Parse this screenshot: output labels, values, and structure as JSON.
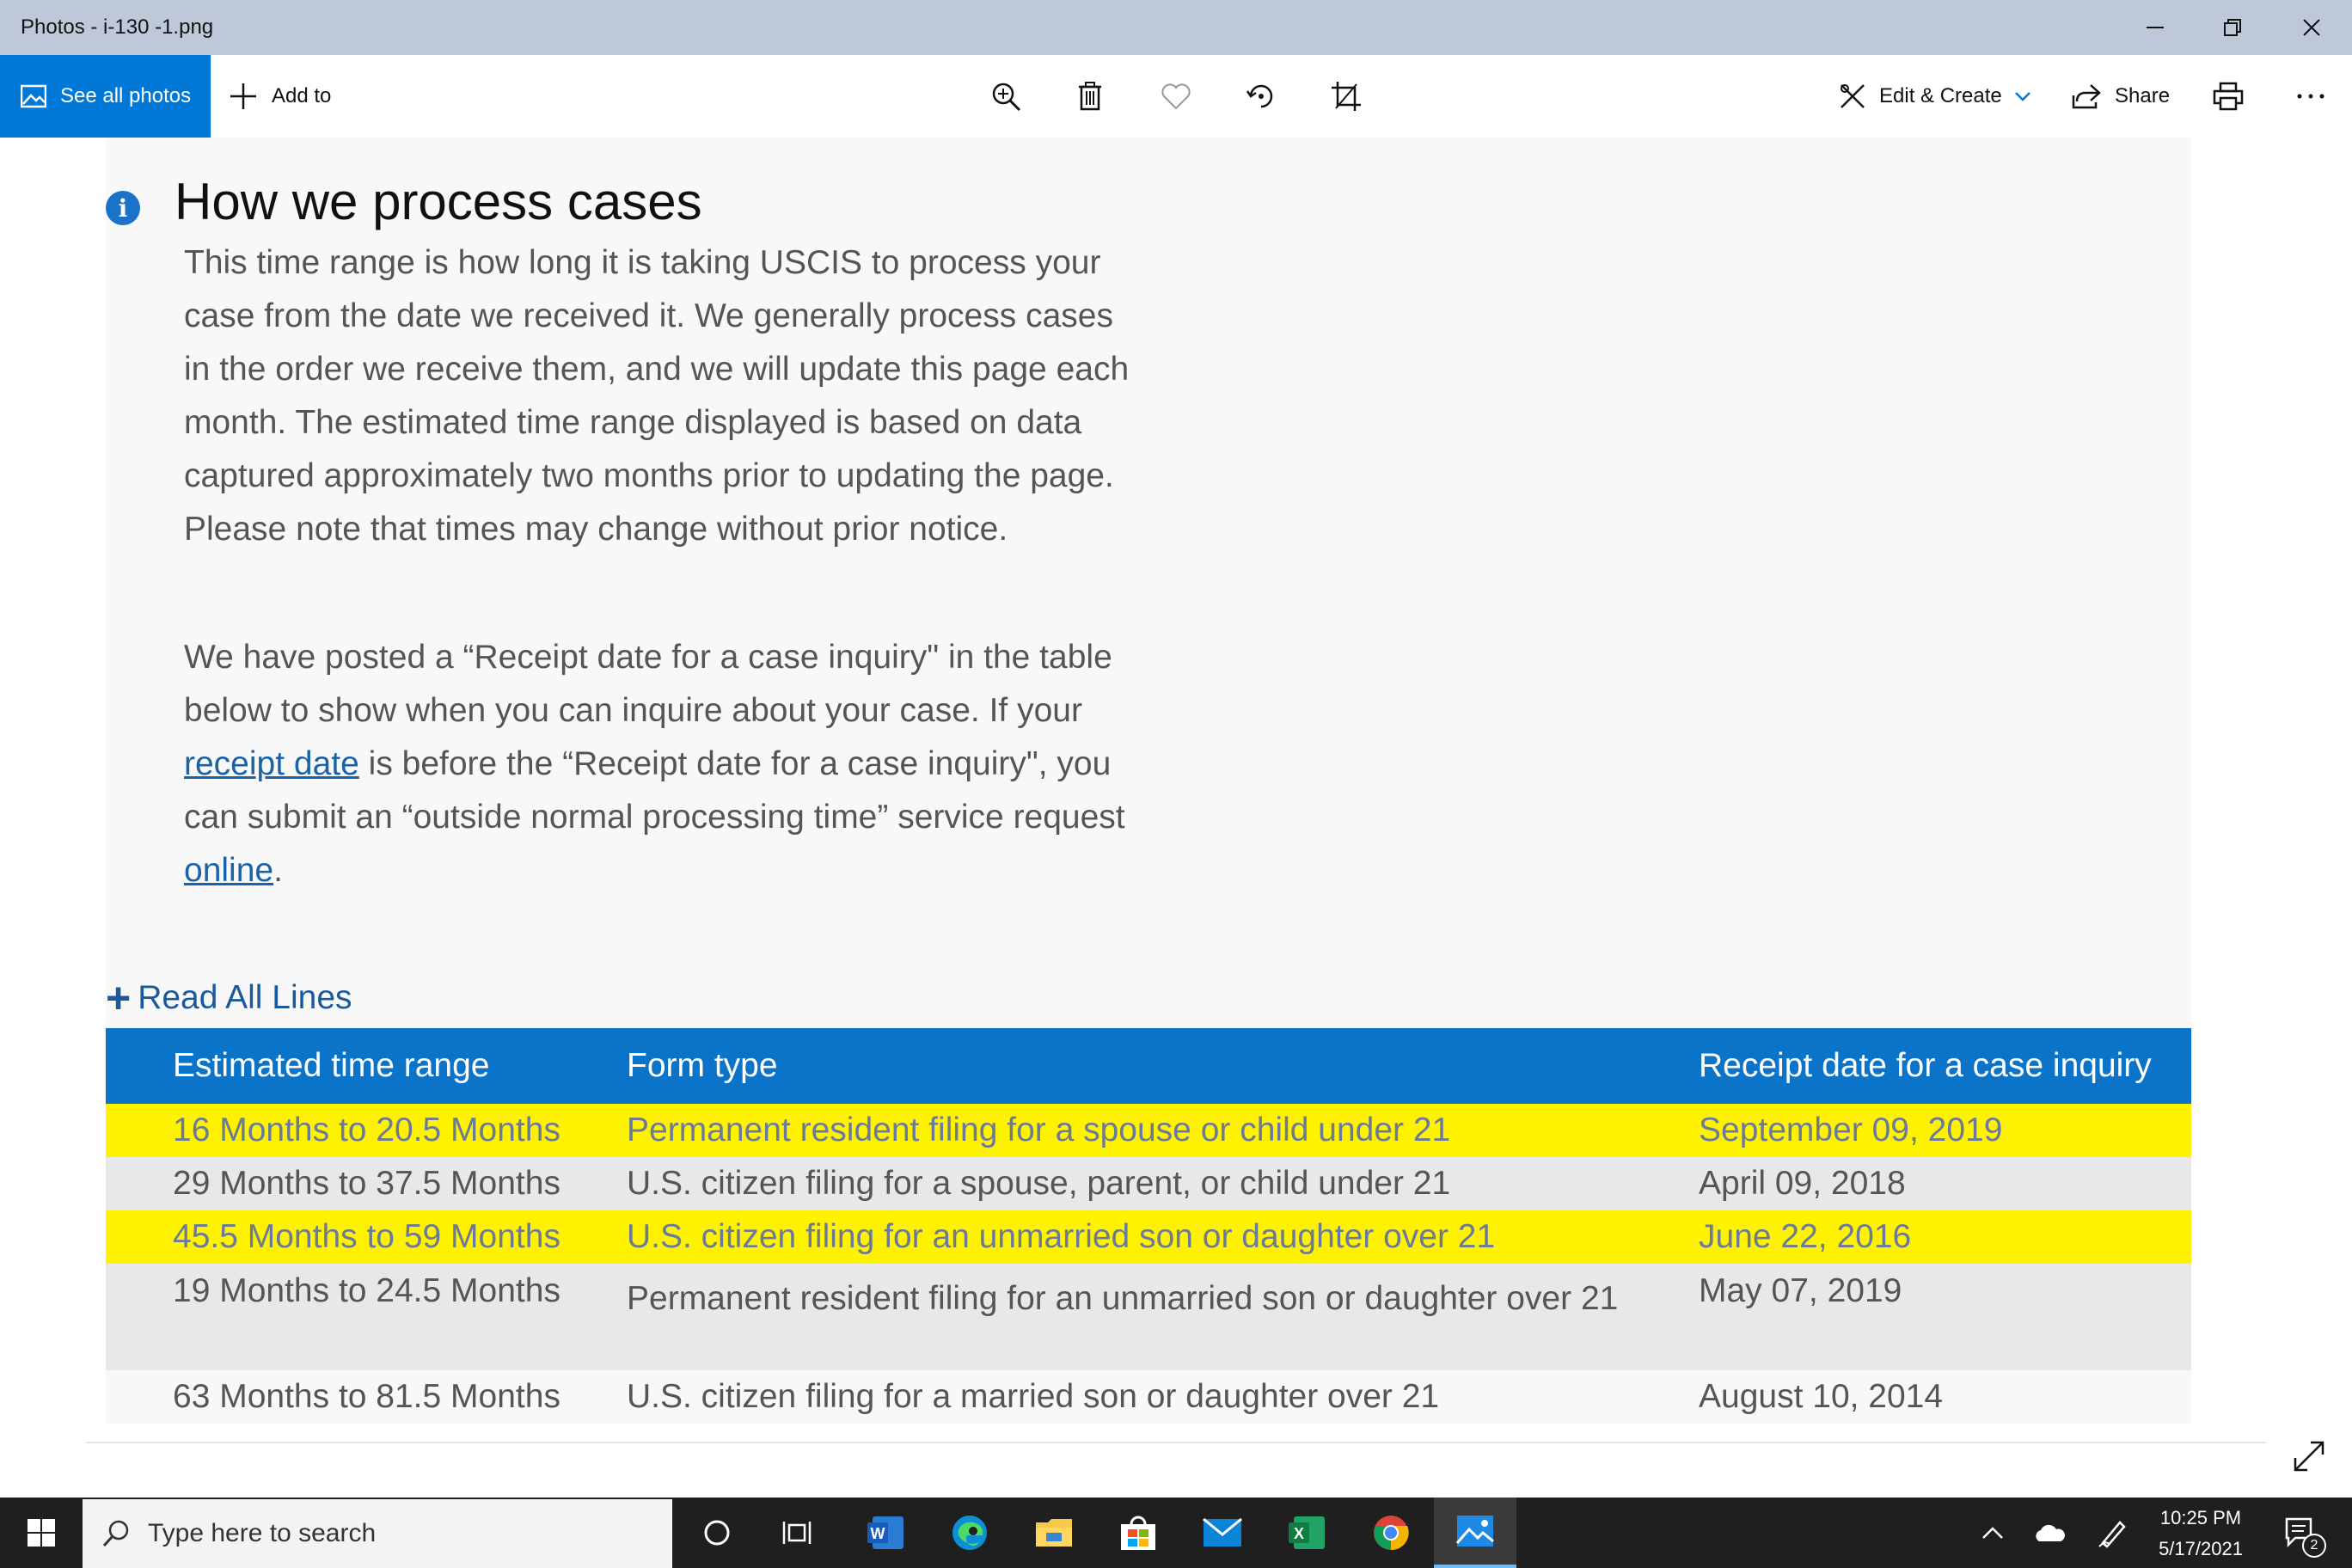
{
  "window": {
    "title": "Photos - i-130 -1.png"
  },
  "toolbar": {
    "see_all_photos": "See all photos",
    "add_to": "Add to",
    "edit_create": "Edit & Create",
    "share": "Share"
  },
  "content": {
    "heading": "How we process cases",
    "para1": "This time range is how long it is taking USCIS to process your case from the date we received it. We generally process cases in the order we receive them, and we will update this page each month. The estimated time range displayed is based on data captured approximately two months prior to updating the page. Please note that times may change without prior notice.",
    "para2_a": "We have posted a “Receipt date for a case inquiry\" in the table below to show when you can inquire about your case. If your ",
    "para2_link1": "receipt date",
    "para2_b": " is before the “Receipt date for a case inquiry\", you can submit an “outside normal processing time” service request ",
    "para2_link2": "online",
    "para2_c": ".",
    "read_all_lines": "Read All Lines"
  },
  "table": {
    "headers": [
      "Estimated time range",
      "Form type",
      "Receipt date for a case inquiry"
    ],
    "rows": [
      {
        "range": "16 Months to 20.5 Months",
        "form": "Permanent resident filing for a spouse or child under 21",
        "date": "September 09, 2019",
        "highlight": true
      },
      {
        "range": "29 Months to 37.5 Months",
        "form": "U.S. citizen filing for a spouse, parent, or child under 21",
        "date": "April 09, 2018",
        "highlight": false
      },
      {
        "range": "45.5 Months to 59 Months",
        "form": "U.S. citizen filing for an unmarried son or daughter over 21",
        "date": "June 22, 2016",
        "highlight": true
      },
      {
        "range": "19 Months to 24.5 Months",
        "form": "Permanent resident filing for an unmarried son or daughter over 21",
        "date": "May 07, 2019",
        "highlight": false
      },
      {
        "range": "63 Months to 81.5 Months",
        "form": "U.S. citizen filing for a married son or daughter over 21",
        "date": "August 10, 2014",
        "highlight": false
      }
    ],
    "highlight_color": "#fff200",
    "header_color": "#0b74c9"
  },
  "taskbar": {
    "search_placeholder": "Type here to search",
    "time": "10:25 PM",
    "date": "5/17/2021",
    "notification_count": "2"
  },
  "colors": {
    "accent": "#0078d7",
    "link": "#1a63a8"
  }
}
